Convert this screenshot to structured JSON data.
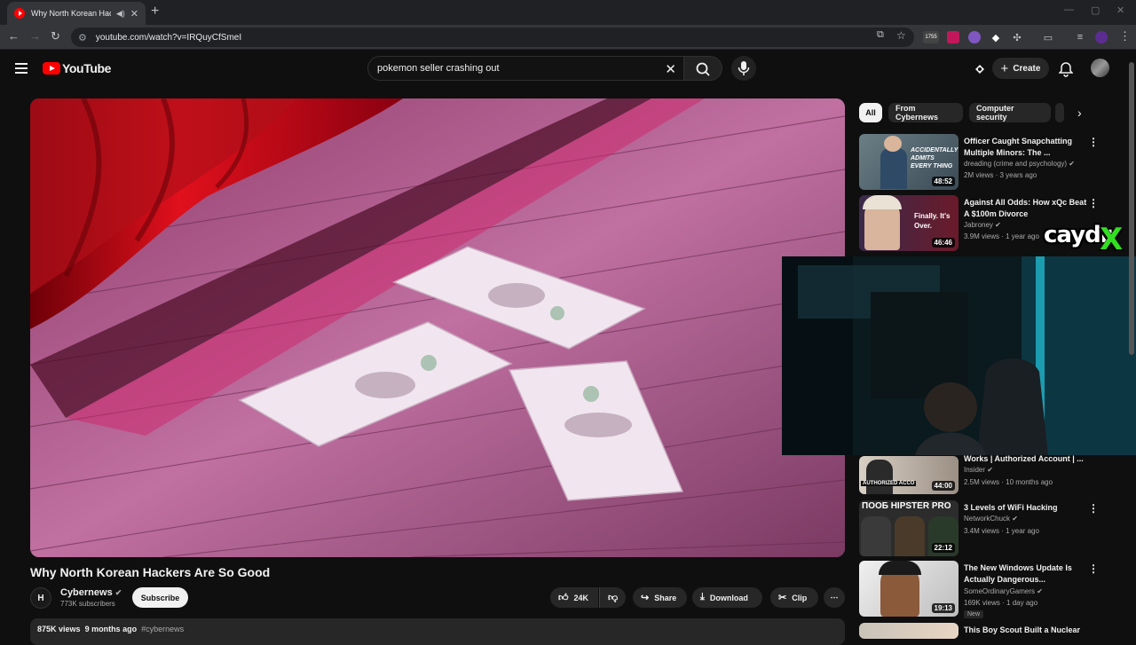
{
  "browser": {
    "tab_title": "Why North Korean Hackers",
    "url": "youtube.com/watch?v=IRQuyCfSmeI",
    "ext_badge": "1755"
  },
  "header": {
    "logo": "YouTube",
    "search_value": "pokemon seller crashing out",
    "create_label": "Create"
  },
  "video": {
    "title": "Why North Korean Hackers Are So Good",
    "channel": "Cybernews",
    "channel_initial": "H",
    "subscribers": "773K subscribers",
    "subscribe_label": "Subscribe",
    "likes": "24K",
    "share_label": "Share",
    "download_label": "Download",
    "clip_label": "Clip",
    "views": "875K views",
    "age": "9 months ago",
    "hashtag": "#cybernews"
  },
  "chips": [
    "All",
    "From Cybernews",
    "Computer security"
  ],
  "recommendations": [
    {
      "title": "Officer Caught Snapchatting Multiple Minors: The ...",
      "channel": "dreading (crime and psychology)",
      "meta": "2M views · 3 years ago",
      "duration": "48:52",
      "thumb_text": "ACCIDENTALLY ADMITS EVERY THING"
    },
    {
      "title": "Against All Odds: How xQc Beat A $100m Divorce",
      "channel": "Jabroney",
      "meta": "3.9M views · 1 year ago",
      "duration": "46:46",
      "thumb_text": "Finally. It's Over."
    },
    {
      "title": "Works | Authorized Account | ...",
      "channel": "Insider",
      "meta": "2.5M views · 10 months ago",
      "duration": "44:00",
      "thumb_text": "AUTHORIZED ACCO"
    },
    {
      "title": "3 Levels of WiFi Hacking",
      "channel": "NetworkChuck",
      "meta": "3.4M views · 1 year ago",
      "duration": "22:12",
      "thumb_text": "ПООБ HIPSTER PRO"
    },
    {
      "title": "The New Windows Update Is Actually Dangerous...",
      "channel": "SomeOrdinaryGamers",
      "meta": "169K views · 1 day ago",
      "duration": "19:13",
      "badge": "New"
    },
    {
      "title": "This Boy Scout Built a Nuclear"
    }
  ],
  "overlay": {
    "streamer_logo": "caydr",
    "streamer_logo_x": "X"
  }
}
